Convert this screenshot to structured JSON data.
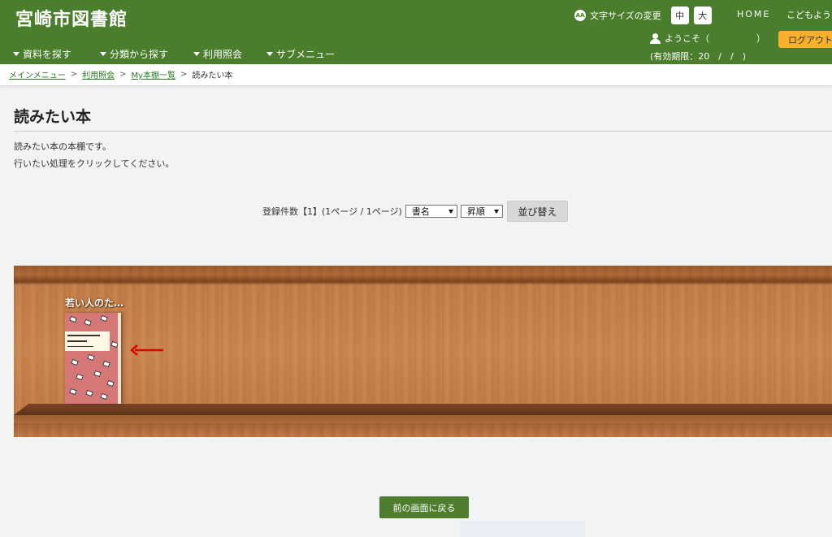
{
  "header": {
    "site_title": "宮崎市図書館",
    "font_size_label": "文字サイズの変更",
    "aa_icon_text": "AA",
    "size_medium": "中",
    "size_large": "大",
    "home": "HOME",
    "kids": "こどもよう",
    "welcome": "ようこそ（",
    "welcome_close": "　　　　　）",
    "expiry": "(有効期限：20　/　/　)",
    "logout": "ログアウト",
    "colors": {
      "bar": "#4a7d2c",
      "logout": "#f6b02c"
    }
  },
  "nav": [
    {
      "label": "資料を探す"
    },
    {
      "label": "分類から探す"
    },
    {
      "label": "利用照会"
    },
    {
      "label": "サブメニュー"
    }
  ],
  "breadcrumb": {
    "items": [
      {
        "label": "メインメニュー"
      },
      {
        "label": "利用照会"
      },
      {
        "label": "My本棚一覧"
      }
    ],
    "separator": ">",
    "current": "読みたい本"
  },
  "main": {
    "title": "読みたい本",
    "desc1": "読みたい本の本棚です。",
    "desc2": "行いたい処理をクリックしてください。",
    "count_text": "登録件数【1】(1ページ / 1ページ)",
    "sort_field": "書名",
    "sort_order": "昇順",
    "sort_button": "並び替え"
  },
  "shelf": {
    "books": [
      {
        "title": "若い人のた…"
      }
    ]
  },
  "footer": {
    "back_button": "前の画面に戻る"
  }
}
